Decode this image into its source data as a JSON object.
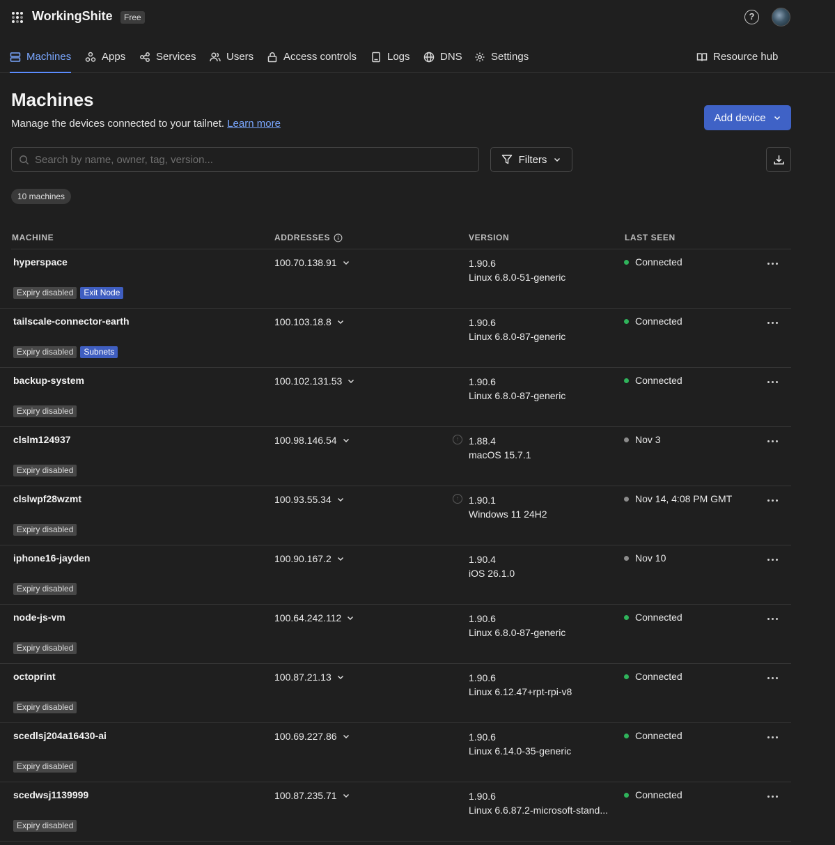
{
  "app": {
    "title": "WorkingShite",
    "plan": "Free",
    "help_glyph": "?"
  },
  "nav": {
    "machines": "Machines",
    "apps": "Apps",
    "services": "Services",
    "users": "Users",
    "access_controls": "Access controls",
    "logs": "Logs",
    "dns": "DNS",
    "settings": "Settings",
    "resource_hub": "Resource hub"
  },
  "page": {
    "title": "Machines",
    "subtitle": "Manage the devices connected to your tailnet.",
    "learn_more": "Learn more",
    "add_device": "Add device",
    "search_placeholder": "Search by name, owner, tag, version...",
    "filters": "Filters",
    "machine_count": "10 machines"
  },
  "table": {
    "headers": {
      "machine": "MACHINE",
      "addresses": "ADDRESSES",
      "version": "VERSION",
      "last_seen": "LAST SEEN"
    },
    "rows": [
      {
        "name": "hyperspace",
        "tags": [
          "Expiry disabled",
          "Exit Node"
        ],
        "address": "100.70.138.91",
        "version": "1.90.6",
        "os": "Linux 6.8.0-51-generic",
        "last_seen": "Connected",
        "online": true,
        "update": false
      },
      {
        "name": "tailscale-connector-earth",
        "tags": [
          "Expiry disabled",
          "Subnets"
        ],
        "address": "100.103.18.8",
        "version": "1.90.6",
        "os": "Linux 6.8.0-87-generic",
        "last_seen": "Connected",
        "online": true,
        "update": false
      },
      {
        "name": "backup-system",
        "tags": [
          "Expiry disabled"
        ],
        "address": "100.102.131.53",
        "version": "1.90.6",
        "os": "Linux 6.8.0-87-generic",
        "last_seen": "Connected",
        "online": true,
        "update": false
      },
      {
        "name": "clslm124937",
        "tags": [
          "Expiry disabled"
        ],
        "address": "100.98.146.54",
        "version": "1.88.4",
        "os": "macOS 15.7.1",
        "last_seen": "Nov 3",
        "online": false,
        "update": true
      },
      {
        "name": "clslwpf28wzmt",
        "tags": [
          "Expiry disabled"
        ],
        "address": "100.93.55.34",
        "version": "1.90.1",
        "os": "Windows 11 24H2",
        "last_seen": "Nov 14, 4:08 PM GMT",
        "online": false,
        "update": true
      },
      {
        "name": "iphone16-jayden",
        "tags": [
          "Expiry disabled"
        ],
        "address": "100.90.167.2",
        "version": "1.90.4",
        "os": "iOS 26.1.0",
        "last_seen": "Nov 10",
        "online": false,
        "update": false
      },
      {
        "name": "node-js-vm",
        "tags": [
          "Expiry disabled"
        ],
        "address": "100.64.242.112",
        "version": "1.90.6",
        "os": "Linux 6.8.0-87-generic",
        "last_seen": "Connected",
        "online": true,
        "update": false
      },
      {
        "name": "octoprint",
        "tags": [
          "Expiry disabled"
        ],
        "address": "100.87.21.13",
        "version": "1.90.6",
        "os": "Linux 6.12.47+rpt-rpi-v8",
        "last_seen": "Connected",
        "online": true,
        "update": false
      },
      {
        "name": "scedlsj204a16430-ai",
        "tags": [
          "Expiry disabled"
        ],
        "address": "100.69.227.86",
        "version": "1.90.6",
        "os": "Linux 6.14.0-35-generic",
        "last_seen": "Connected",
        "online": true,
        "update": false
      },
      {
        "name": "scedwsj1139999",
        "tags": [
          "Expiry disabled"
        ],
        "address": "100.87.235.71",
        "version": "1.90.6",
        "os": "Linux 6.6.87.2-microsoft-stand...",
        "last_seen": "Connected",
        "online": true,
        "update": false
      }
    ]
  },
  "colors": {
    "accent": "#5b8cff",
    "button": "#3f62c6",
    "online": "#2fb35b",
    "offline": "#8c8c8c",
    "background": "#1f1f1f"
  },
  "icons": [
    "app-grid-icon",
    "help-icon",
    "machines-icon",
    "apps-icon",
    "services-icon",
    "users-icon",
    "lock-icon",
    "logs-icon",
    "globe-icon",
    "gear-icon",
    "book-icon",
    "search-icon",
    "filter-icon",
    "chevron-down-icon",
    "download-icon",
    "info-icon",
    "update-available-icon",
    "more-icon"
  ]
}
